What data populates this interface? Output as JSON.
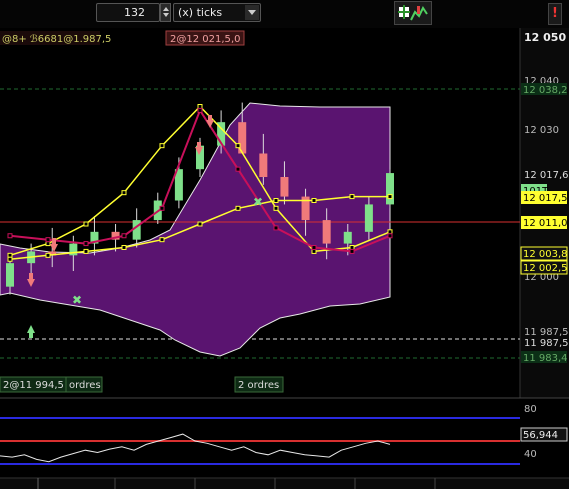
{
  "toolbar": {
    "period_value": "132",
    "unit_label": "(x) ticks",
    "alert_label": "!",
    "tool_icon": "indicator-tool-icon"
  },
  "price_axis": {
    "ticks": [
      "12 050",
      "12 040",
      "12 030",
      "12 020",
      "12 000",
      "11 987,5"
    ],
    "badges": {
      "dashed_top": "12 038,2",
      "upper": "12 017,6",
      "green_tag": "101T",
      "current": "12 017,5",
      "red_line": "12 011,0",
      "mid_a": "12 003,8",
      "mid_b": "12 002,5",
      "dashed_low": "11 987,5",
      "bottom_green": "11 983,4"
    }
  },
  "orders": {
    "top_left": "2@12 021,5",
    "top_left_suffix": ",0",
    "top_far_left": "@8+ ℬ6681@1.987,5",
    "bottom_left": "2@11 994,5",
    "bottom_left_suffix": "ordres",
    "bottom_mid": "2 ordres"
  },
  "oscillator": {
    "ticks": [
      "80",
      "40"
    ],
    "value_badge": "56,944",
    "line_values": [
      47,
      46,
      48,
      44,
      42,
      46,
      49,
      52,
      50,
      53,
      55,
      52,
      57,
      60,
      63,
      66,
      60,
      58,
      55,
      52,
      55,
      50,
      48,
      52,
      50,
      48,
      47,
      46,
      52,
      55,
      58,
      60,
      57
    ]
  },
  "colors": {
    "bg": "#000000",
    "purple": "#5a1470",
    "candle_up": "#7fe08a",
    "candle_down": "#f07a7a",
    "ma_yellow": "#ffff30",
    "ma_crimson": "#c8105a",
    "red_line": "#d83030",
    "grid_green": "#1f6a2f",
    "band_white": "#e8e8e8"
  },
  "chart_data": {
    "type": "candlestick",
    "y_unit": "price",
    "ylim": [
      11980,
      12052
    ],
    "candles": [
      [
        11988,
        11996,
        11986,
        11994
      ],
      [
        11994,
        11999,
        11990,
        11997
      ],
      [
        11997,
        12003,
        11993,
        11996
      ],
      [
        11996,
        12001,
        11992,
        11999
      ],
      [
        11999,
        12006,
        11996,
        12002
      ],
      [
        12002,
        12004,
        11997,
        12000
      ],
      [
        12000,
        12008,
        11998,
        12005
      ],
      [
        12005,
        12012,
        12004,
        12010
      ],
      [
        12010,
        12021,
        12008,
        12018
      ],
      [
        12018,
        12026,
        12016,
        12024
      ],
      [
        12024,
        12033,
        12022,
        12030
      ],
      [
        12030,
        12035,
        12026,
        12022
      ],
      [
        12022,
        12027,
        12014,
        12016
      ],
      [
        12016,
        12020,
        12009,
        12011
      ],
      [
        12011,
        12013,
        12001,
        12005
      ],
      [
        12005,
        12008,
        11995,
        11999
      ],
      [
        11999,
        12004,
        11996,
        12002
      ],
      [
        12002,
        12011,
        12000,
        12009
      ],
      [
        12009,
        12018,
        12008,
        12017
      ]
    ],
    "series": [
      {
        "values": [
          11996,
          11999,
          12004,
          12012,
          12024,
          12034,
          12024,
          12008,
          11997,
          11998,
          12002
        ]
      },
      {
        "values": [
          11995,
          11996,
          11997,
          11998,
          12000,
          12004,
          12008,
          12010,
          12010,
          12011,
          12011
        ]
      },
      {
        "values": [
          12001,
          12000,
          11999,
          12001,
          12008,
          12033,
          12018,
          12003,
          11998,
          11997,
          12001
        ]
      }
    ]
  }
}
